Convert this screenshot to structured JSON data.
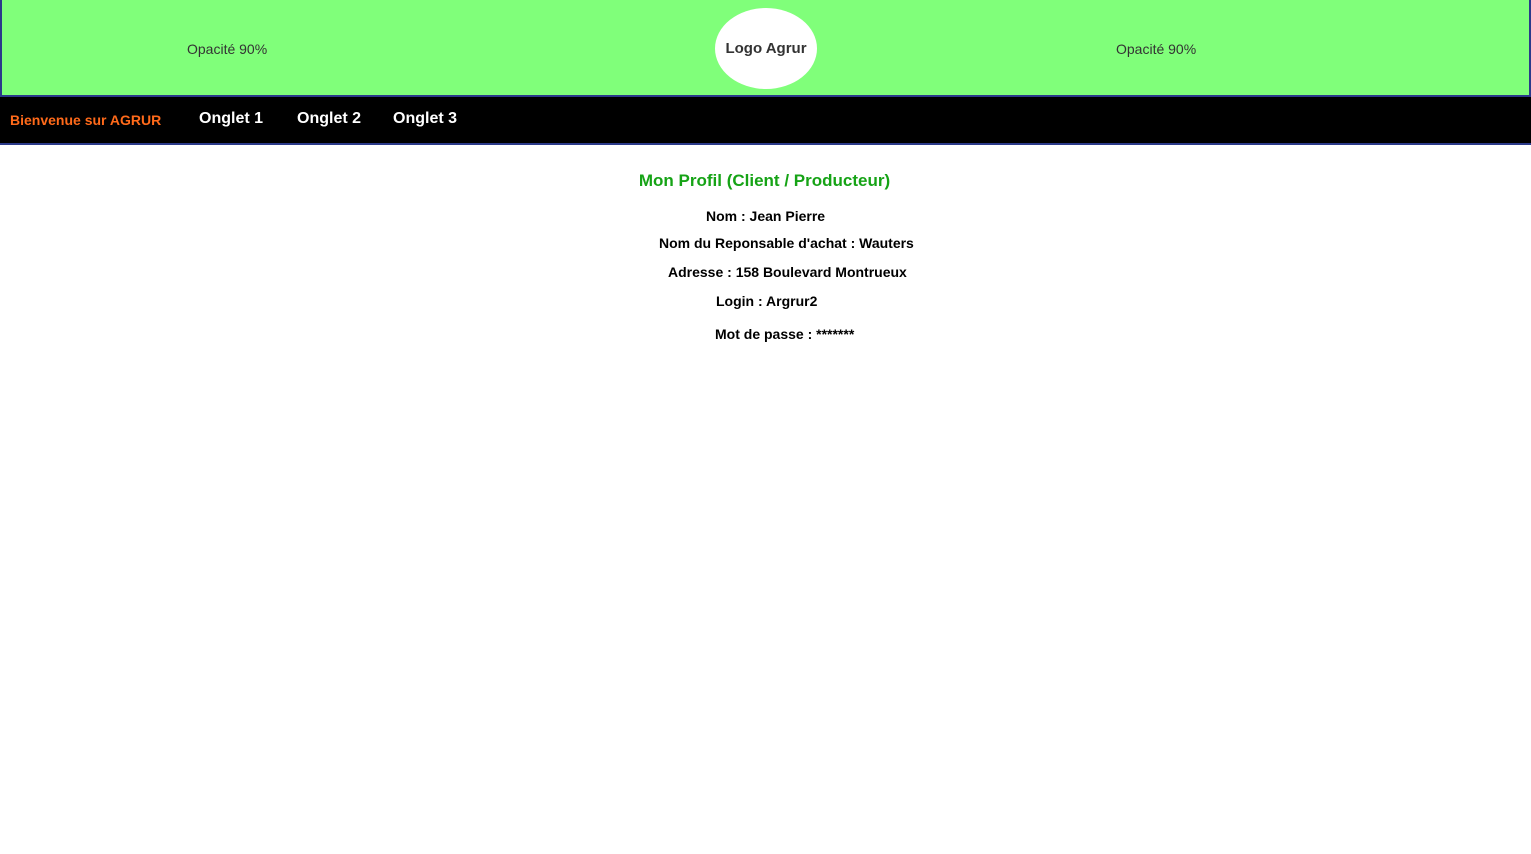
{
  "header": {
    "opacity_left": "Opacité 90%",
    "logo": "Logo Agrur",
    "opacity_right": "Opacité 90%",
    "background_color": "#80ff7a"
  },
  "nav": {
    "welcome": "Bienvenue sur AGRUR",
    "tabs": [
      {
        "label": "Onglet 1"
      },
      {
        "label": "Onglet 2"
      },
      {
        "label": "Onglet 3"
      }
    ],
    "background_color": "#000000",
    "welcome_color": "#ff6a1a"
  },
  "profile": {
    "title": "Mon Profil (Client / Producteur)",
    "title_color": "#16a316",
    "fields": {
      "nom": "Nom : Jean Pierre",
      "responsable": "Nom du Reponsable d'achat : Wauters",
      "adresse": "Adresse : 158 Boulevard Montrueux",
      "login": "Login : Argrur2",
      "mot_de_passe": "Mot de passe : *******"
    }
  }
}
